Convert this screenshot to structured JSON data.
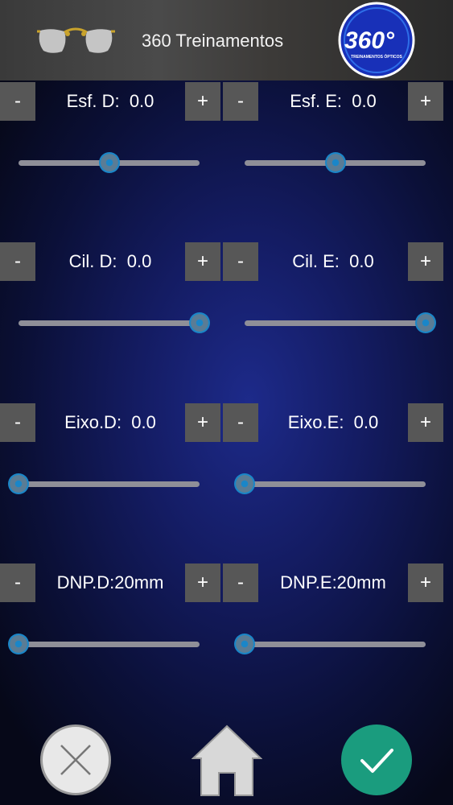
{
  "header": {
    "title": "360 Treinamentos",
    "logo_text": "360°",
    "logo_subtext": "TREINAMENTOS ÓPTICOS"
  },
  "buttons": {
    "minus": "-",
    "plus": "+"
  },
  "rows": [
    {
      "right": {
        "label": "Esf. D:  0.0",
        "slider_level": 0.5
      },
      "left": {
        "label": "Esf. E:  0.0",
        "slider_level": 0.5
      }
    },
    {
      "right": {
        "label": "Cil. D:  0.0",
        "slider_level": 1.0
      },
      "left": {
        "label": "Cil. E:  0.0",
        "slider_level": 1.0
      }
    },
    {
      "right": {
        "label": "Eixo.D:  0.0",
        "slider_level": 0.0
      },
      "left": {
        "label": "Eixo.E:  0.0",
        "slider_level": 0.0
      }
    },
    {
      "right": {
        "label": "DNP.D:20mm",
        "slider_level": 0.0
      },
      "left": {
        "label": "DNP.E:20mm",
        "slider_level": 0.0
      }
    }
  ],
  "colors": {
    "button": "#575757",
    "track": "#8f8f98",
    "thumb": "#1a86c8",
    "confirm": "#1a9c7e",
    "cancel": "#e8e8e8"
  },
  "icons": {
    "cancel": "close-icon",
    "home": "home-icon",
    "confirm": "check-icon",
    "app": "glasses-icon"
  }
}
